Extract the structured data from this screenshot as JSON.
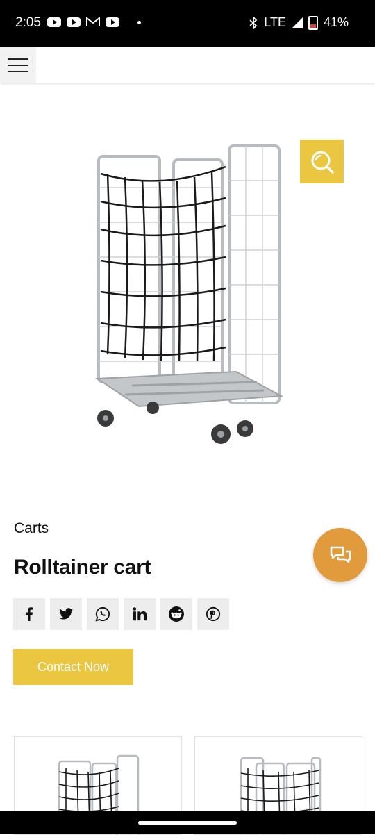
{
  "status_bar": {
    "time": "2:05",
    "network": "LTE",
    "battery": "41%"
  },
  "product": {
    "category": "Carts",
    "title": "Rolltainer cart",
    "contact_label": "Contact Now"
  },
  "share": {
    "networks": [
      "facebook",
      "twitter",
      "whatsapp",
      "linkedin",
      "reddit",
      "pinterest"
    ]
  },
  "colors": {
    "accent": "#ebc640",
    "chat": "#e19b3c"
  }
}
